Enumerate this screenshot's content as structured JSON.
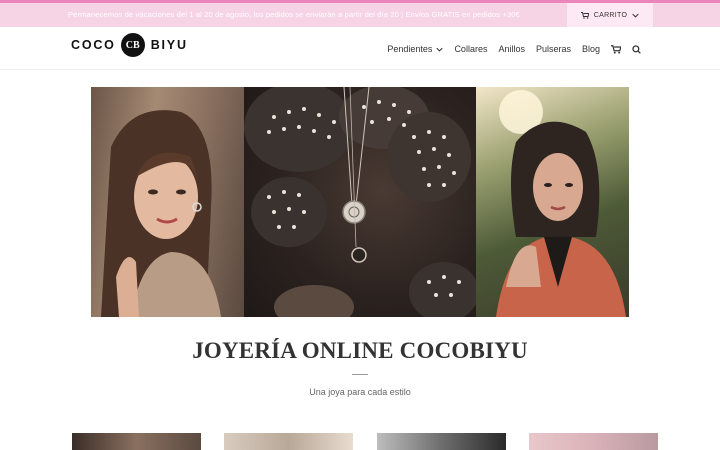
{
  "topbar": {
    "announcement": "Permanecemos de vacaciones del 1 al 20 de agosto, los pedidos se enviarán a partir del día 20 | Envíos GRATIS en pedidos +30€",
    "cart_label": "CARRITO"
  },
  "header": {
    "logo_left": "COCO",
    "logo_mark": "CB",
    "logo_right": "BIYU",
    "nav": [
      {
        "label": "Pendientes",
        "has_dropdown": true
      },
      {
        "label": "Collares"
      },
      {
        "label": "Anillos"
      },
      {
        "label": "Pulseras"
      },
      {
        "label": "Blog"
      }
    ],
    "icons": [
      "cart-icon",
      "search-icon"
    ]
  },
  "hero": {
    "panels": [
      "woman-with-earrings-photo",
      "necklaces-on-cactus-photo",
      "woman-in-orange-blazer-photo"
    ]
  },
  "main": {
    "title": "JOYERÍA ONLINE COCOBIYU",
    "subtitle": "Una joya para cada estilo"
  },
  "colors": {
    "topbar_bg": "#f7d3e6",
    "topbar_accent": "#ea86bc",
    "cart_bg": "#fde9f3",
    "text": "#333333"
  }
}
